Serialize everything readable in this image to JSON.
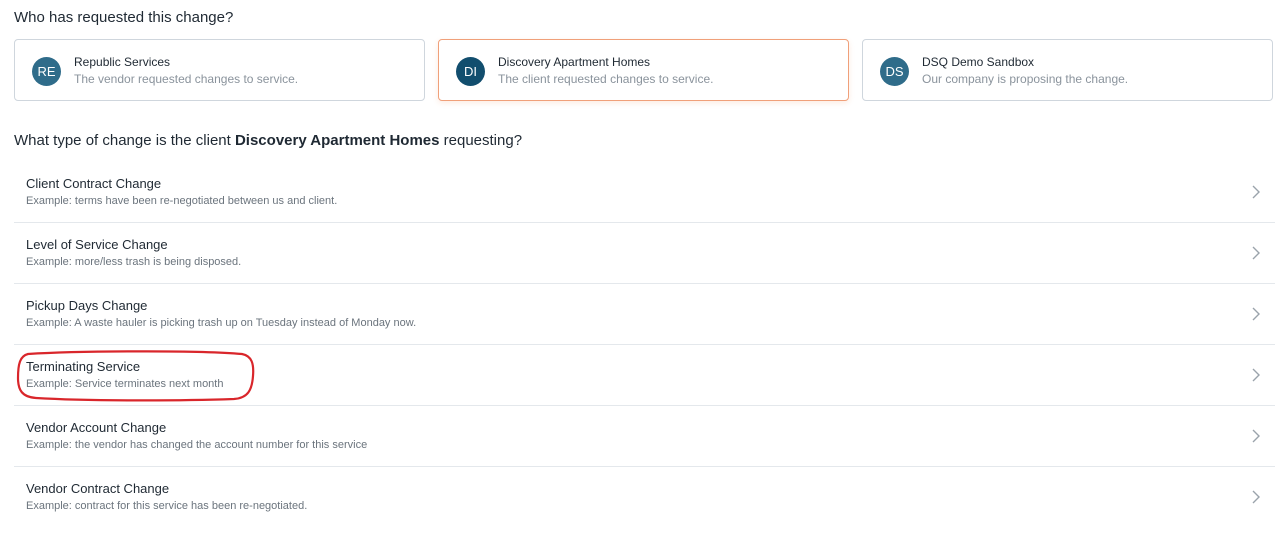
{
  "question_requester": "Who has requested this change?",
  "requesters": [
    {
      "initials": "RE",
      "name": "Republic Services",
      "description": "The vendor requested changes to service.",
      "selected": false
    },
    {
      "initials": "DI",
      "name": "Discovery Apartment Homes",
      "description": "The client requested changes to service.",
      "selected": true
    },
    {
      "initials": "DS",
      "name": "DSQ Demo Sandbox",
      "description": "Our company is proposing the change.",
      "selected": false
    }
  ],
  "question_type": {
    "prefix": "What type of change is the client ",
    "client": "Discovery Apartment Homes",
    "suffix": " requesting?"
  },
  "change_types": [
    {
      "title": "Client Contract Change",
      "example": "Example: terms have been re-negotiated between us and client."
    },
    {
      "title": "Level of Service Change",
      "example": "Example: more/less trash is being disposed."
    },
    {
      "title": "Pickup Days Change",
      "example": "Example: A waste hauler is picking trash up on Tuesday instead of Monday now."
    },
    {
      "title": "Terminating Service",
      "example": "Example: Service terminates next month"
    },
    {
      "title": "Vendor Account Change",
      "example": "Example: the vendor has changed the account number for this service"
    },
    {
      "title": "Vendor Contract Change",
      "example": "Example: contract for this service has been re-negotiated."
    }
  ],
  "colors": {
    "selected_border": "#f0a07a",
    "highlight_annotation": "#d9262b",
    "avatar_primary": "#2f6c8a",
    "avatar_selected": "#124e6e"
  },
  "icons": {
    "row_chevron": "chevron-right-icon"
  }
}
